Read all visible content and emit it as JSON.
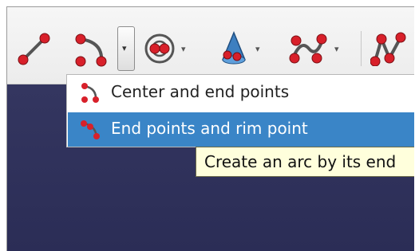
{
  "toolbar": {
    "items": [
      {
        "icon": "line-tool-icon"
      },
      {
        "icon": "arc-tool-icon"
      },
      {
        "icon": "circle-tool-icon"
      },
      {
        "icon": "cone-tool-icon"
      },
      {
        "icon": "bspline-tool-icon"
      },
      {
        "icon": "polyline-tool-icon"
      }
    ],
    "dropdown_glyph": "▾"
  },
  "menu": {
    "items": [
      {
        "label": "Center and end points",
        "icon": "arc-center-icon",
        "selected": false
      },
      {
        "label": "End points and rim point",
        "icon": "arc-endpoints-icon",
        "selected": true
      }
    ]
  },
  "tooltip": {
    "text": "Create an arc by its end"
  },
  "colors": {
    "viewport": "#2c2e58",
    "selection": "#3a85c7",
    "tooltip_bg": "#ffffdc",
    "point_red": "#d8202a"
  }
}
